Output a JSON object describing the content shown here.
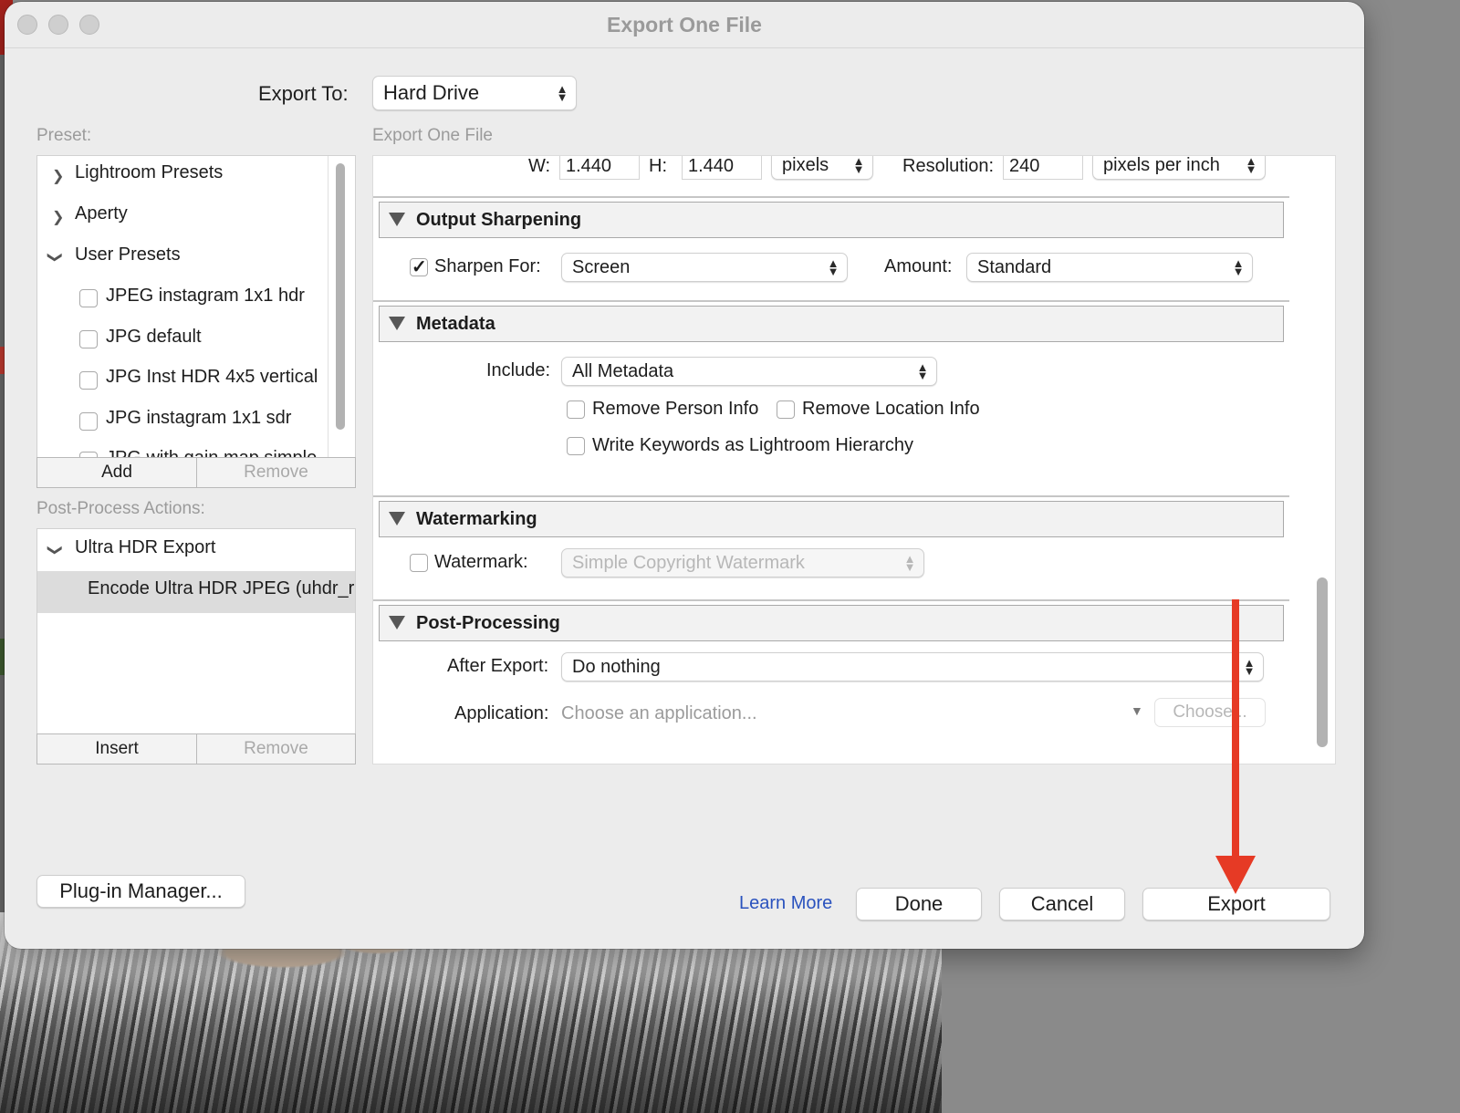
{
  "window": {
    "title": "Export One File"
  },
  "export_to": {
    "label": "Export To:",
    "value": "Hard Drive"
  },
  "preset": {
    "caption": "Preset:",
    "items": [
      {
        "label": "Lightroom Presets",
        "expanded": false
      },
      {
        "label": "Aperty",
        "expanded": false
      },
      {
        "label": "User Presets",
        "expanded": true
      }
    ],
    "user_presets": [
      "JPEG instagram 1x1 hdr",
      "JPG default",
      "JPG Inst HDR 4x5 vertical",
      "JPG instagram 1x1 sdr",
      "JPG with gain map simple"
    ],
    "add_label": "Add",
    "remove_label": "Remove"
  },
  "post_process": {
    "caption": "Post-Process Actions:",
    "group": "Ultra HDR Export",
    "action": "Encode Ultra HDR JPEG (uhdr_r",
    "insert_label": "Insert",
    "remove_label": "Remove"
  },
  "settings_caption": "Export One File",
  "size": {
    "w_label": "W:",
    "w_value": "1.440",
    "h_label": "H:",
    "h_value": "1.440",
    "unit": "pixels",
    "resolution_label": "Resolution:",
    "resolution_value": "240",
    "resolution_unit": "pixels per inch"
  },
  "output_sharpening": {
    "title": "Output Sharpening",
    "sharpen_for_label": "Sharpen For:",
    "sharpen_for_checked": true,
    "sharpen_for_value": "Screen",
    "amount_label": "Amount:",
    "amount_value": "Standard"
  },
  "metadata": {
    "title": "Metadata",
    "include_label": "Include:",
    "include_value": "All Metadata",
    "remove_person": "Remove Person Info",
    "remove_location": "Remove Location Info",
    "write_keywords": "Write Keywords as Lightroom Hierarchy"
  },
  "watermarking": {
    "title": "Watermarking",
    "watermark_label": "Watermark:",
    "watermark_value": "Simple Copyright Watermark"
  },
  "post_processing": {
    "title": "Post-Processing",
    "after_export_label": "After Export:",
    "after_export_value": "Do nothing",
    "application_label": "Application:",
    "application_placeholder": "Choose an application...",
    "choose_label": "Choose..."
  },
  "footer": {
    "plugin_manager": "Plug-in Manager...",
    "learn_more": "Learn More",
    "done": "Done",
    "cancel": "Cancel",
    "export": "Export"
  },
  "colors": {
    "annotation_arrow": "#e63a25",
    "link": "#2a52be"
  }
}
